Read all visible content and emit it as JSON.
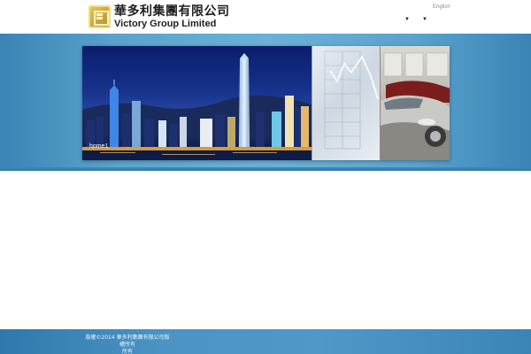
{
  "header": {
    "logo_name_cn": "華多利集團有限公司",
    "logo_name_en": "Victory Group Limited",
    "language_link": "English",
    "nav_arrow_1": "▼",
    "nav_arrow_2": "▼"
  },
  "banner": {
    "caption": "home1"
  },
  "footer": {
    "copyright_line1": "版權©2014 華多利集團有限公司版權所有",
    "copyright_line2": "所有"
  },
  "colors": {
    "band_blue": "#5aa3cd",
    "footer_blue": "#3b84b6"
  }
}
